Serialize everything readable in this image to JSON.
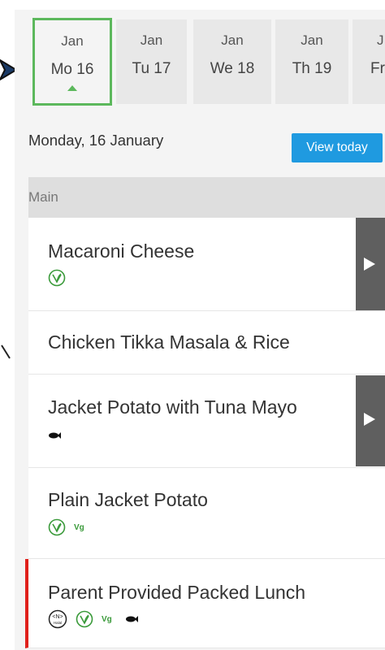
{
  "date_strip": {
    "days": [
      {
        "month": "Jan",
        "day": "Mo 16",
        "selected": true
      },
      {
        "month": "Jan",
        "day": "Tu 17"
      },
      {
        "month": "Jan",
        "day": "We 18"
      },
      {
        "month": "Jan",
        "day": "Th 19"
      },
      {
        "month": "J",
        "day": "Fr"
      }
    ]
  },
  "header": {
    "date_title": "Monday, 16 January",
    "view_today_label": "View today"
  },
  "category": {
    "label": "Main"
  },
  "menu_items": [
    {
      "name": "Macaroni Cheese",
      "icons": [
        "vegetarian-icon"
      ],
      "expandable": true
    },
    {
      "name": "Chicken Tikka Masala & Rice",
      "icons": [],
      "expandable": false
    },
    {
      "name": "Jacket Potato with Tuna Mayo",
      "icons": [
        "fish-icon"
      ],
      "expandable": true
    },
    {
      "name": "Plain Jacket Potato",
      "icons": [
        "vegetarian-icon",
        "vegan-icon"
      ],
      "vegan_label": "Vg",
      "expandable": false
    },
    {
      "name": "Parent Provided Packed Lunch",
      "icons": [
        "halal-icon",
        "vegetarian-icon",
        "vegan-icon",
        "fish-icon"
      ],
      "vegan_label": "Vg",
      "halal_label": "Halal",
      "expandable": false
    }
  ],
  "colors": {
    "accent_blue": "#1f9ae0",
    "selected_green": "#5cb85c",
    "veg_green": "#3a9a3a",
    "alert_red": "#e0201b",
    "expander_gray": "#5f5f5f"
  }
}
